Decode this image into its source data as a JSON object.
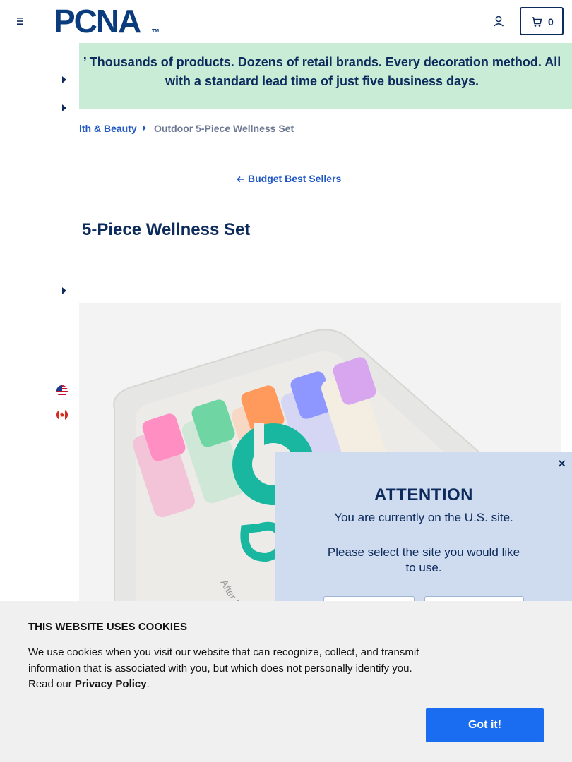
{
  "header": {
    "logo_text": "PCNA",
    "logo_tm": "TM",
    "cart_count": "0"
  },
  "banner": {
    "text": "’ Thousands of products. Dozens of retail brands. Every decoration method. All with a standard lead time of just five business days."
  },
  "breadcrumb": {
    "parent": "lth & Beauty",
    "current": "Outdoor 5-Piece Wellness Set"
  },
  "back_link": "Budget Best Sellers",
  "product": {
    "title": "5-Piece Wellness Set",
    "image_label": "After Sun"
  },
  "attention": {
    "title": "ATTENTION",
    "line1": "You are currently on the U.S. site.",
    "line2": "Please select the site you would like to use.",
    "close": "×"
  },
  "cookie": {
    "title": "THIS WEBSITE USES COOKIES",
    "body": "We use cookies when you visit our website that can recognize, collect, and transmit information that is associated with you, but which does not personally identify you. Read our ",
    "privacy_link": "Privacy Policy",
    "period": ".",
    "button": "Got it!"
  },
  "colors": {
    "navy": "#0c2a5c",
    "link_blue": "#1f57c3",
    "banner_green": "#c8ecd6",
    "modal_blue": "#cfdcef",
    "button_blue": "#1a6cf0"
  },
  "icons": [
    "hamburger-icon",
    "user-icon",
    "cart-icon",
    "chevron-right-icon",
    "arrow-left-icon",
    "us-flag-icon",
    "canada-flag-icon",
    "close-icon"
  ]
}
